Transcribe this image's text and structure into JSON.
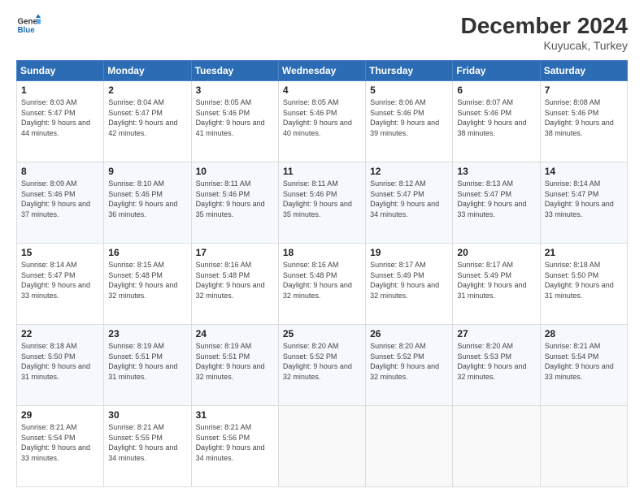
{
  "logo": {
    "line1": "General",
    "line2": "Blue"
  },
  "title": "December 2024",
  "location": "Kuyucak, Turkey",
  "days_of_week": [
    "Sunday",
    "Monday",
    "Tuesday",
    "Wednesday",
    "Thursday",
    "Friday",
    "Saturday"
  ],
  "weeks": [
    [
      {
        "day": "1",
        "sunrise": "Sunrise: 8:03 AM",
        "sunset": "Sunset: 5:47 PM",
        "daylight": "Daylight: 9 hours and 44 minutes."
      },
      {
        "day": "2",
        "sunrise": "Sunrise: 8:04 AM",
        "sunset": "Sunset: 5:47 PM",
        "daylight": "Daylight: 9 hours and 42 minutes."
      },
      {
        "day": "3",
        "sunrise": "Sunrise: 8:05 AM",
        "sunset": "Sunset: 5:46 PM",
        "daylight": "Daylight: 9 hours and 41 minutes."
      },
      {
        "day": "4",
        "sunrise": "Sunrise: 8:05 AM",
        "sunset": "Sunset: 5:46 PM",
        "daylight": "Daylight: 9 hours and 40 minutes."
      },
      {
        "day": "5",
        "sunrise": "Sunrise: 8:06 AM",
        "sunset": "Sunset: 5:46 PM",
        "daylight": "Daylight: 9 hours and 39 minutes."
      },
      {
        "day": "6",
        "sunrise": "Sunrise: 8:07 AM",
        "sunset": "Sunset: 5:46 PM",
        "daylight": "Daylight: 9 hours and 38 minutes."
      },
      {
        "day": "7",
        "sunrise": "Sunrise: 8:08 AM",
        "sunset": "Sunset: 5:46 PM",
        "daylight": "Daylight: 9 hours and 38 minutes."
      }
    ],
    [
      {
        "day": "8",
        "sunrise": "Sunrise: 8:09 AM",
        "sunset": "Sunset: 5:46 PM",
        "daylight": "Daylight: 9 hours and 37 minutes."
      },
      {
        "day": "9",
        "sunrise": "Sunrise: 8:10 AM",
        "sunset": "Sunset: 5:46 PM",
        "daylight": "Daylight: 9 hours and 36 minutes."
      },
      {
        "day": "10",
        "sunrise": "Sunrise: 8:11 AM",
        "sunset": "Sunset: 5:46 PM",
        "daylight": "Daylight: 9 hours and 35 minutes."
      },
      {
        "day": "11",
        "sunrise": "Sunrise: 8:11 AM",
        "sunset": "Sunset: 5:46 PM",
        "daylight": "Daylight: 9 hours and 35 minutes."
      },
      {
        "day": "12",
        "sunrise": "Sunrise: 8:12 AM",
        "sunset": "Sunset: 5:47 PM",
        "daylight": "Daylight: 9 hours and 34 minutes."
      },
      {
        "day": "13",
        "sunrise": "Sunrise: 8:13 AM",
        "sunset": "Sunset: 5:47 PM",
        "daylight": "Daylight: 9 hours and 33 minutes."
      },
      {
        "day": "14",
        "sunrise": "Sunrise: 8:14 AM",
        "sunset": "Sunset: 5:47 PM",
        "daylight": "Daylight: 9 hours and 33 minutes."
      }
    ],
    [
      {
        "day": "15",
        "sunrise": "Sunrise: 8:14 AM",
        "sunset": "Sunset: 5:47 PM",
        "daylight": "Daylight: 9 hours and 33 minutes."
      },
      {
        "day": "16",
        "sunrise": "Sunrise: 8:15 AM",
        "sunset": "Sunset: 5:48 PM",
        "daylight": "Daylight: 9 hours and 32 minutes."
      },
      {
        "day": "17",
        "sunrise": "Sunrise: 8:16 AM",
        "sunset": "Sunset: 5:48 PM",
        "daylight": "Daylight: 9 hours and 32 minutes."
      },
      {
        "day": "18",
        "sunrise": "Sunrise: 8:16 AM",
        "sunset": "Sunset: 5:48 PM",
        "daylight": "Daylight: 9 hours and 32 minutes."
      },
      {
        "day": "19",
        "sunrise": "Sunrise: 8:17 AM",
        "sunset": "Sunset: 5:49 PM",
        "daylight": "Daylight: 9 hours and 32 minutes."
      },
      {
        "day": "20",
        "sunrise": "Sunrise: 8:17 AM",
        "sunset": "Sunset: 5:49 PM",
        "daylight": "Daylight: 9 hours and 31 minutes."
      },
      {
        "day": "21",
        "sunrise": "Sunrise: 8:18 AM",
        "sunset": "Sunset: 5:50 PM",
        "daylight": "Daylight: 9 hours and 31 minutes."
      }
    ],
    [
      {
        "day": "22",
        "sunrise": "Sunrise: 8:18 AM",
        "sunset": "Sunset: 5:50 PM",
        "daylight": "Daylight: 9 hours and 31 minutes."
      },
      {
        "day": "23",
        "sunrise": "Sunrise: 8:19 AM",
        "sunset": "Sunset: 5:51 PM",
        "daylight": "Daylight: 9 hours and 31 minutes."
      },
      {
        "day": "24",
        "sunrise": "Sunrise: 8:19 AM",
        "sunset": "Sunset: 5:51 PM",
        "daylight": "Daylight: 9 hours and 32 minutes."
      },
      {
        "day": "25",
        "sunrise": "Sunrise: 8:20 AM",
        "sunset": "Sunset: 5:52 PM",
        "daylight": "Daylight: 9 hours and 32 minutes."
      },
      {
        "day": "26",
        "sunrise": "Sunrise: 8:20 AM",
        "sunset": "Sunset: 5:52 PM",
        "daylight": "Daylight: 9 hours and 32 minutes."
      },
      {
        "day": "27",
        "sunrise": "Sunrise: 8:20 AM",
        "sunset": "Sunset: 5:53 PM",
        "daylight": "Daylight: 9 hours and 32 minutes."
      },
      {
        "day": "28",
        "sunrise": "Sunrise: 8:21 AM",
        "sunset": "Sunset: 5:54 PM",
        "daylight": "Daylight: 9 hours and 33 minutes."
      }
    ],
    [
      {
        "day": "29",
        "sunrise": "Sunrise: 8:21 AM",
        "sunset": "Sunset: 5:54 PM",
        "daylight": "Daylight: 9 hours and 33 minutes."
      },
      {
        "day": "30",
        "sunrise": "Sunrise: 8:21 AM",
        "sunset": "Sunset: 5:55 PM",
        "daylight": "Daylight: 9 hours and 34 minutes."
      },
      {
        "day": "31",
        "sunrise": "Sunrise: 8:21 AM",
        "sunset": "Sunset: 5:56 PM",
        "daylight": "Daylight: 9 hours and 34 minutes."
      },
      null,
      null,
      null,
      null
    ]
  ]
}
